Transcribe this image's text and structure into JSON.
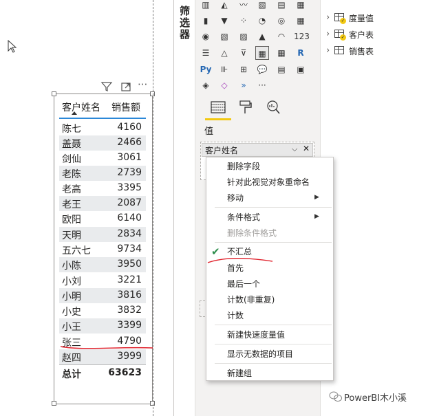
{
  "table": {
    "columns": [
      "客户姓名",
      "销售额"
    ],
    "rows": [
      {
        "name": "陈七",
        "value": "4160"
      },
      {
        "name": "盖聂",
        "value": "2466"
      },
      {
        "name": "剑仙",
        "value": "3061"
      },
      {
        "name": "老陈",
        "value": "2739"
      },
      {
        "name": "老高",
        "value": "3395"
      },
      {
        "name": "老王",
        "value": "2087"
      },
      {
        "name": "欧阳",
        "value": "6140"
      },
      {
        "name": "天明",
        "value": "2834"
      },
      {
        "name": "五六七",
        "value": "9734"
      },
      {
        "name": "小陈",
        "value": "3950"
      },
      {
        "name": "小刘",
        "value": "3221"
      },
      {
        "name": "小明",
        "value": "3816"
      },
      {
        "name": "小史",
        "value": "3832"
      },
      {
        "name": "小王",
        "value": "3399"
      },
      {
        "name": "张三",
        "value": "4790"
      },
      {
        "name": "赵四",
        "value": "3999"
      }
    ],
    "total": {
      "name": "总计",
      "value": "63623"
    }
  },
  "filters_label": "筛选器",
  "visualizations": {
    "values_label": "值",
    "field": "客户姓名",
    "more": "···"
  },
  "fields": [
    {
      "label": "度量值",
      "icon": "measure-table-icon",
      "checked": true
    },
    {
      "label": "客户表",
      "icon": "table-icon",
      "checked": true
    },
    {
      "label": "销售表",
      "icon": "table-icon",
      "checked": false
    }
  ],
  "context_menu": {
    "items": [
      {
        "label": "删除字段"
      },
      {
        "label": "针对此视觉对象重命名"
      },
      {
        "label": "移动",
        "submenu": true
      },
      {
        "label": "条件格式",
        "submenu": true
      },
      {
        "label": "删除条件格式",
        "disabled": true
      },
      {
        "label": "不汇总",
        "checked": true
      },
      {
        "label": "首先"
      },
      {
        "label": "最后一个"
      },
      {
        "label": "计数(非重复)"
      },
      {
        "label": "计数"
      },
      {
        "label": "新建快速度量值"
      },
      {
        "label": "显示无数据的项目"
      },
      {
        "label": "新建组"
      }
    ]
  },
  "watermark": "PowerBI木小溪",
  "colors": {
    "accent": "#f2c811",
    "header_line": "#2b88d8",
    "annotation": "#e0202a",
    "check": "#2a8c4a"
  }
}
